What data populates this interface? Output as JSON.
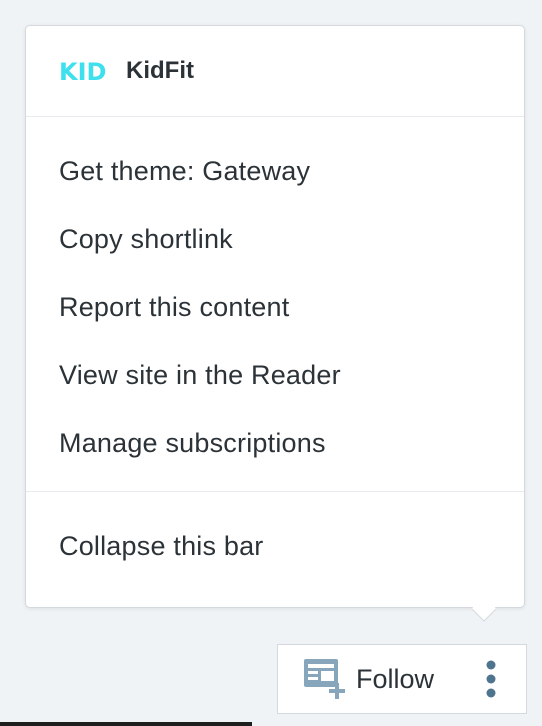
{
  "site": {
    "name": "KidFit",
    "logo_text": "KID",
    "logo_color": "#3fe0ee"
  },
  "menu": {
    "items": [
      {
        "label": "Get theme: Gateway"
      },
      {
        "label": "Copy shortlink"
      },
      {
        "label": "Report this content"
      },
      {
        "label": "View site in the Reader"
      },
      {
        "label": "Manage subscriptions"
      }
    ],
    "footer_item": "Collapse this bar"
  },
  "follow_bar": {
    "follow_label": "Follow",
    "follow_icon": "reader-follow-icon",
    "more_icon": "vertical-ellipsis-icon",
    "icon_color": "#87a6bc"
  }
}
